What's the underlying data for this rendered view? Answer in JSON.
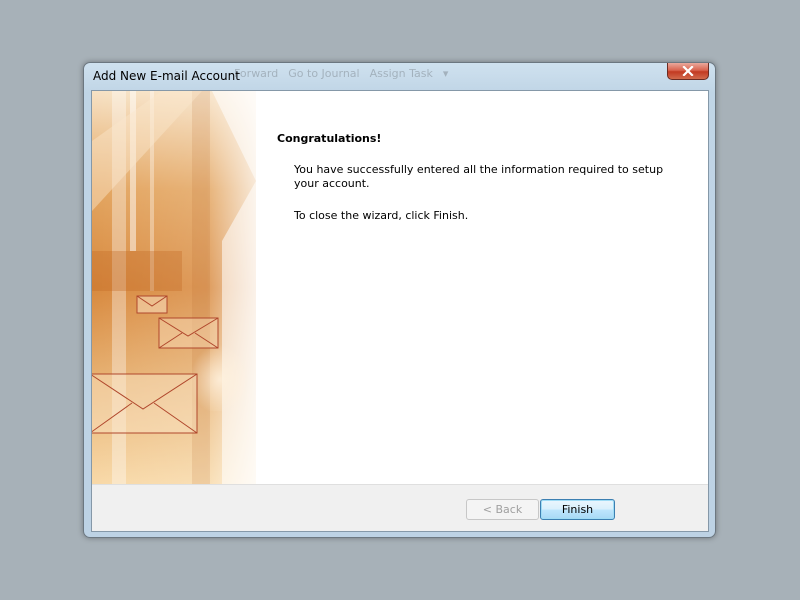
{
  "window": {
    "title": "Add New E-mail Account",
    "background_toolbar": [
      "Forward",
      "Go to Journal",
      "Assign Task",
      "▾"
    ]
  },
  "content": {
    "heading": "Congratulations!",
    "line1": "You have successfully entered all the information required to setup your account.",
    "line2": "To close the wizard, click Finish."
  },
  "buttons": {
    "back": "< Back",
    "finish": "Finish"
  },
  "colors": {
    "banner_orange": "#d88a3c",
    "banner_light": "#fbe6c9",
    "finish_border": "#3c7fb1",
    "close_red": "#c23a22"
  }
}
